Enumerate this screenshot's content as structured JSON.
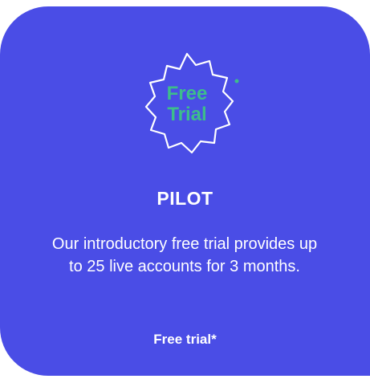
{
  "card": {
    "background": "#4a4de6",
    "badge": {
      "icon": "starburst-badge-icon",
      "line1": "Free",
      "line2": "Trial",
      "text_color": "#3dbd8b"
    },
    "title": "PILOT",
    "description": "Our introductory free trial provides up to 25 live accounts for 3 months.",
    "price_label": "Free trial*"
  }
}
